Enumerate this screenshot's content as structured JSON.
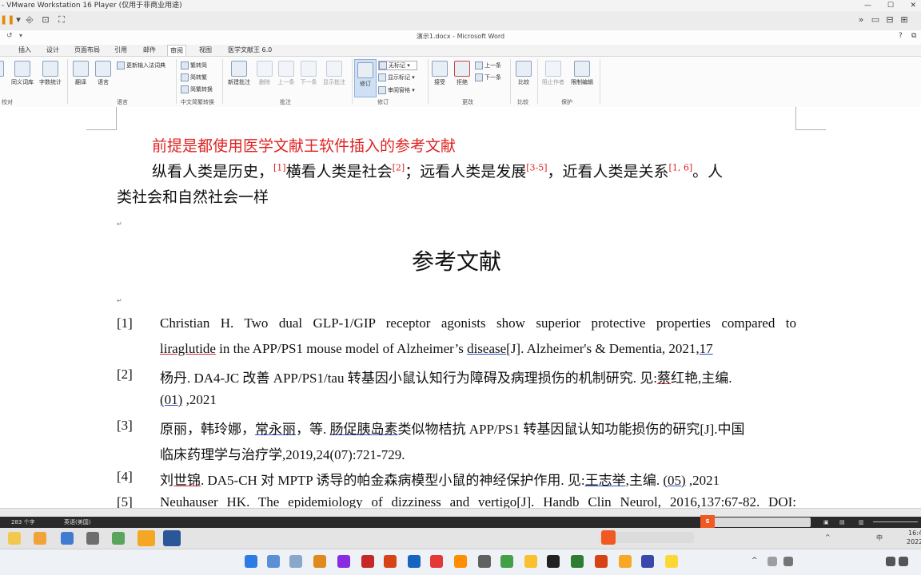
{
  "vmware": {
    "title": "- VMware Workstation 16 Player (仅用于非商业用途)"
  },
  "word": {
    "title": "演示1.docx - Microsoft Word",
    "tabs": [
      "插入",
      "设计",
      "页面布局",
      "引用",
      "邮件",
      "审阅",
      "视图",
      "医学文献王 6.0"
    ],
    "active_tab": "审阅",
    "ribbon": {
      "thesaurus": "同义词库",
      "wordcount": "字数统计",
      "translate": "翻译",
      "language": "语言",
      "update_ime": "更新输入法词典",
      "trad_to_simp": "繁转简",
      "simp_to_trad": "简转繁",
      "conv": "简繁转换",
      "new_comment": "新建批注",
      "delete": "删除",
      "prev": "上一条",
      "next": "下一条",
      "show_comments": "显示批注",
      "track": "修订",
      "no_markup": "无标记",
      "show_markup": "显示标记",
      "review_pane": "审阅窗格",
      "accept": "接受",
      "reject": "拒绝",
      "prev_change": "上一条",
      "next_change": "下一条",
      "compare": "比较",
      "block_authors": "阻止作者",
      "restrict": "限制编辑",
      "groups": {
        "proofing": "校对",
        "language": "语言",
        "chinese": "中文简繁转换",
        "comments": "批注",
        "tracking": "修订",
        "changes": "更改",
        "compare": "比较",
        "protect": "保护"
      }
    }
  },
  "document": {
    "premise": "前提是都使用医学文献王软件插入的参考文献",
    "body_parts": {
      "p1": "纵看人类是历史，",
      "c1": "[1]",
      "p2": "横看人类是社会",
      "c2": "[2]",
      "p3": "；远看人类是发展",
      "c3": "[3-5]",
      "p4": "，近看人类是关系",
      "c4": "[1, 6]",
      "p5": "。人",
      "line2": "类社会和自然社会一样"
    },
    "heading": "参考文献",
    "references": [
      {
        "num": "[1]",
        "l1": "Christian H. Two dual GLP-1/GIP receptor agonists show superior protective properties compared to",
        "l2a": "liraglutide",
        "l2b": " in the APP/PS1 mouse model of Alzheimer’s ",
        "l2c": "disease",
        "l2d": "[J]. Alzheimer's & Dementia, 2021,",
        "l2e": "17"
      },
      {
        "num": "[2]",
        "l1a": "杨丹. DA4-JC  改善  APP/PS1/tau  转基因小鼠认知行为障碍及病理损伤的机制研究.  见:",
        "l1b": "蔡",
        "l1c": "红艳,主编.",
        "l2a": "(01)",
        "l2b": " ,2021"
      },
      {
        "num": "[3]",
        "l1a": "原丽，韩玲娜，",
        "l1b": "常永丽",
        "l1c": "，等.  ",
        "l1d": "肠促胰岛素",
        "l1e": "类似物桔抗  APP/PS1  转基因鼠认知功能损伤的研究[J].中国",
        "l2": "临床药理学与治疗学,2019,24(07):721-729."
      },
      {
        "num": "[4]",
        "l1a": "刘",
        "l1b": "世锦",
        "l1c": ". DA5-CH 对 MPTP 诱导的帕金森病模型小鼠的神经保护作用.  见:",
        "l1d": "王志举",
        "l1e": ",主编. ",
        "l1f": "(05)",
        "l1g": " ,2021"
      },
      {
        "num": "[5]",
        "l1": "Neuhauser HK. The epidemiology of dizziness and vertigo[J]. Handb Clin Neurol, 2016,137:67-82. DOI:"
      }
    ]
  },
  "statusbar": {
    "words": "283 个字",
    "lang": "英语(美国)"
  },
  "tray": {
    "ime": "中",
    "time": "16:4",
    "date": "2022"
  }
}
